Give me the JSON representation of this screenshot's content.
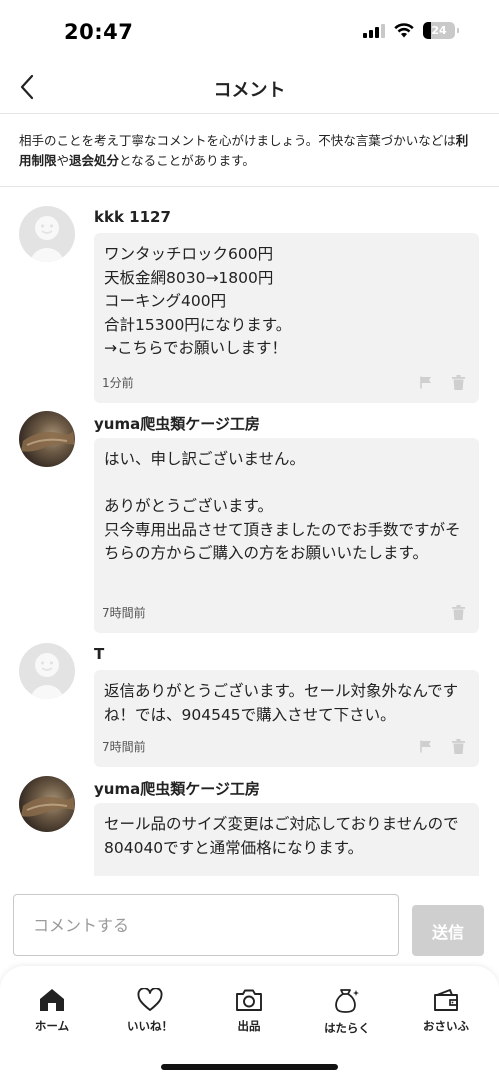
{
  "status_bar": {
    "time": "20:47",
    "battery": "24"
  },
  "header": {
    "title": "コメント"
  },
  "notice": {
    "part1": "相手のことを考え丁寧なコメントを心がけましょう。不快な言葉づかいなどは",
    "strong1": "利用制限",
    "part2": "や",
    "strong2": "退会処分",
    "part3": "となることがあります。"
  },
  "comments": [
    {
      "user": "kkk 1127",
      "text": "ワンタッチロック600円\n天板金網8030→1800円\nコーキング400円\n合計15300円になります。\n→こちらでお願いします！",
      "time": "1分前",
      "avatar": "default-avatar-icon"
    },
    {
      "user": "yuma爬虫類ケージ工房",
      "text": "はい、申し訳ございません。\n\nありがとうございます。\n只今専用出品させて頂きましたのでお手数ですがそちらの方からご購入の方をお願いいたします。",
      "time": "7時間前",
      "avatar": "user-photo"
    },
    {
      "user": "T",
      "text": "返信ありがとうございます。セール対象外なんですね！では、904545で購入させて下さい。",
      "time": "7時間前",
      "avatar": "default-avatar-icon"
    },
    {
      "user": "yuma爬虫類ケージ工房",
      "text": "セール品のサイズ変更はご対応しておりませんので804040ですと通常価格になります。",
      "time": "",
      "avatar": "user-photo"
    }
  ],
  "input": {
    "placeholder": "コメントする",
    "send_label": "送信"
  },
  "tabs": [
    {
      "label": "ホーム",
      "icon": "home-icon"
    },
    {
      "label": "いいね！",
      "icon": "heart-icon"
    },
    {
      "label": "出品",
      "icon": "camera-icon"
    },
    {
      "label": "はたらく",
      "icon": "money-bag-icon"
    },
    {
      "label": "おさいふ",
      "icon": "wallet-icon"
    }
  ],
  "colors": {
    "send_button": "#cfcfcf",
    "bubble": "#f2f2f2",
    "divider": "#e6e6e6"
  }
}
